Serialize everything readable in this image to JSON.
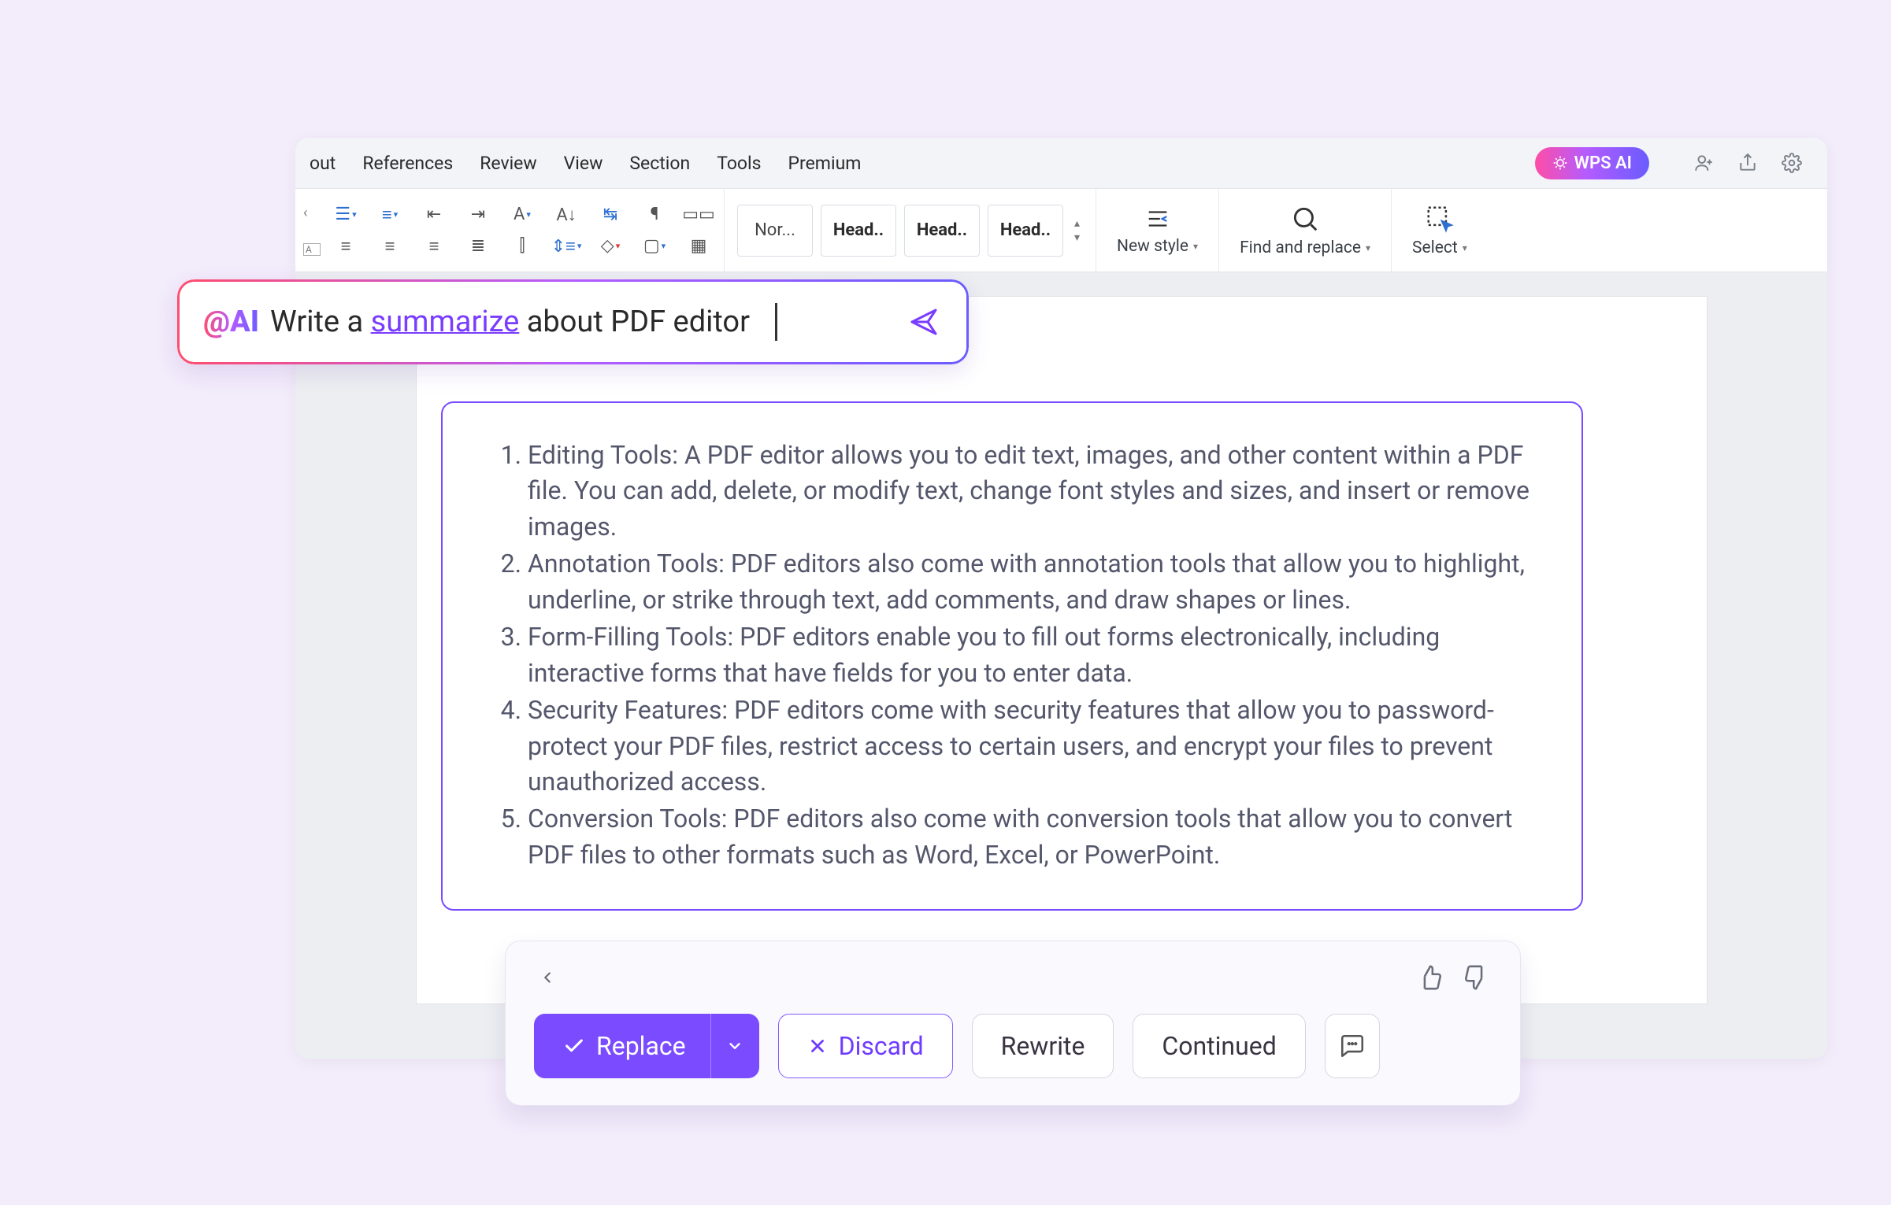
{
  "menubar": {
    "items": [
      "out",
      "References",
      "Review",
      "View",
      "Section",
      "Tools",
      "Premium"
    ],
    "wps_ai": "WPS AI"
  },
  "ribbon": {
    "styles": {
      "normal": "Nor...",
      "head1": "Head..",
      "head2": "Head..",
      "head3": "Head.."
    },
    "new_style": "New style",
    "find_replace": "Find and replace",
    "select": "Select"
  },
  "ai_bar": {
    "tag": "@AI",
    "pre": "Write a ",
    "underlined": "summarize",
    "post": " about PDF editor"
  },
  "generated": {
    "items": [
      "Editing Tools: A PDF editor allows you to edit text, images, and other content within a PDF file. You can add, delete, or modify text, change font styles and sizes, and insert or remove images.",
      "Annotation Tools: PDF editors also come with annotation tools that allow you to highlight, underline, or strike through text, add comments, and draw shapes or lines.",
      "Form-Filling Tools: PDF editors enable you to fill out forms electronically, including interactive forms that have fields for you to enter data.",
      "Security Features: PDF editors come with security features that allow you to password-protect your PDF files, restrict access to certain users, and encrypt your files to prevent unauthorized access.",
      "Conversion Tools: PDF editors also come with conversion tools that allow you to convert PDF files to other formats such as Word, Excel, or PowerPoint."
    ]
  },
  "actions": {
    "replace": "Replace",
    "discard": "Discard",
    "rewrite": "Rewrite",
    "continued": "Continued"
  }
}
